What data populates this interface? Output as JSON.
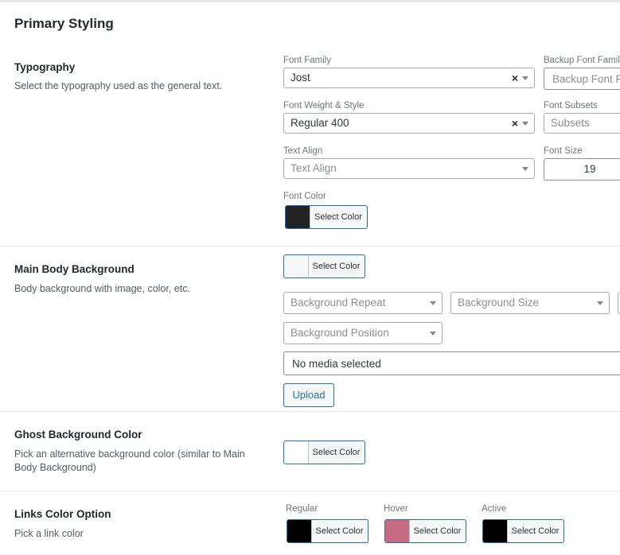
{
  "page": {
    "title": "Primary Styling"
  },
  "typography": {
    "title": "Typography",
    "description": "Select the typography used as the general text.",
    "font_family": {
      "label": "Font Family",
      "value": "Jost"
    },
    "backup_font_family": {
      "label": "Backup Font Famil",
      "placeholder": "Backup Font F"
    },
    "font_weight": {
      "label": "Font Weight & Style",
      "value": "Regular 400"
    },
    "font_subsets": {
      "label": "Font Subsets",
      "placeholder": "Subsets"
    },
    "text_align": {
      "label": "Text Align",
      "placeholder": "Text Align"
    },
    "font_size": {
      "label": "Font Size",
      "value": "19"
    },
    "font_color": {
      "label": "Font Color",
      "button": "Select Color",
      "color": "#222222"
    }
  },
  "main_body_background": {
    "title": "Main Body Background",
    "description": "Body background with image, color, etc.",
    "color_button": "Select Color",
    "color": "#f6f7f7",
    "background_repeat": {
      "placeholder": "Background Repeat"
    },
    "background_size": {
      "placeholder": "Background Size"
    },
    "background_position": {
      "placeholder": "Background Position"
    },
    "media": {
      "value": "No media selected"
    },
    "upload_button": "Upload"
  },
  "ghost_background": {
    "title": "Ghost Background Color",
    "description": "Pick an alternative background color (similar to Main Body Background)",
    "color_button": "Select Color",
    "color": "#ffffff"
  },
  "links_color": {
    "title": "Links Color Option",
    "description": "Pick a link color",
    "regular": {
      "label": "Regular",
      "button": "Select Color",
      "color": "#000000"
    },
    "hover": {
      "label": "Hover",
      "button": "Select Color",
      "color": "#c76b84"
    },
    "active": {
      "label": "Active",
      "button": "Select Color",
      "color": "#000000"
    }
  }
}
